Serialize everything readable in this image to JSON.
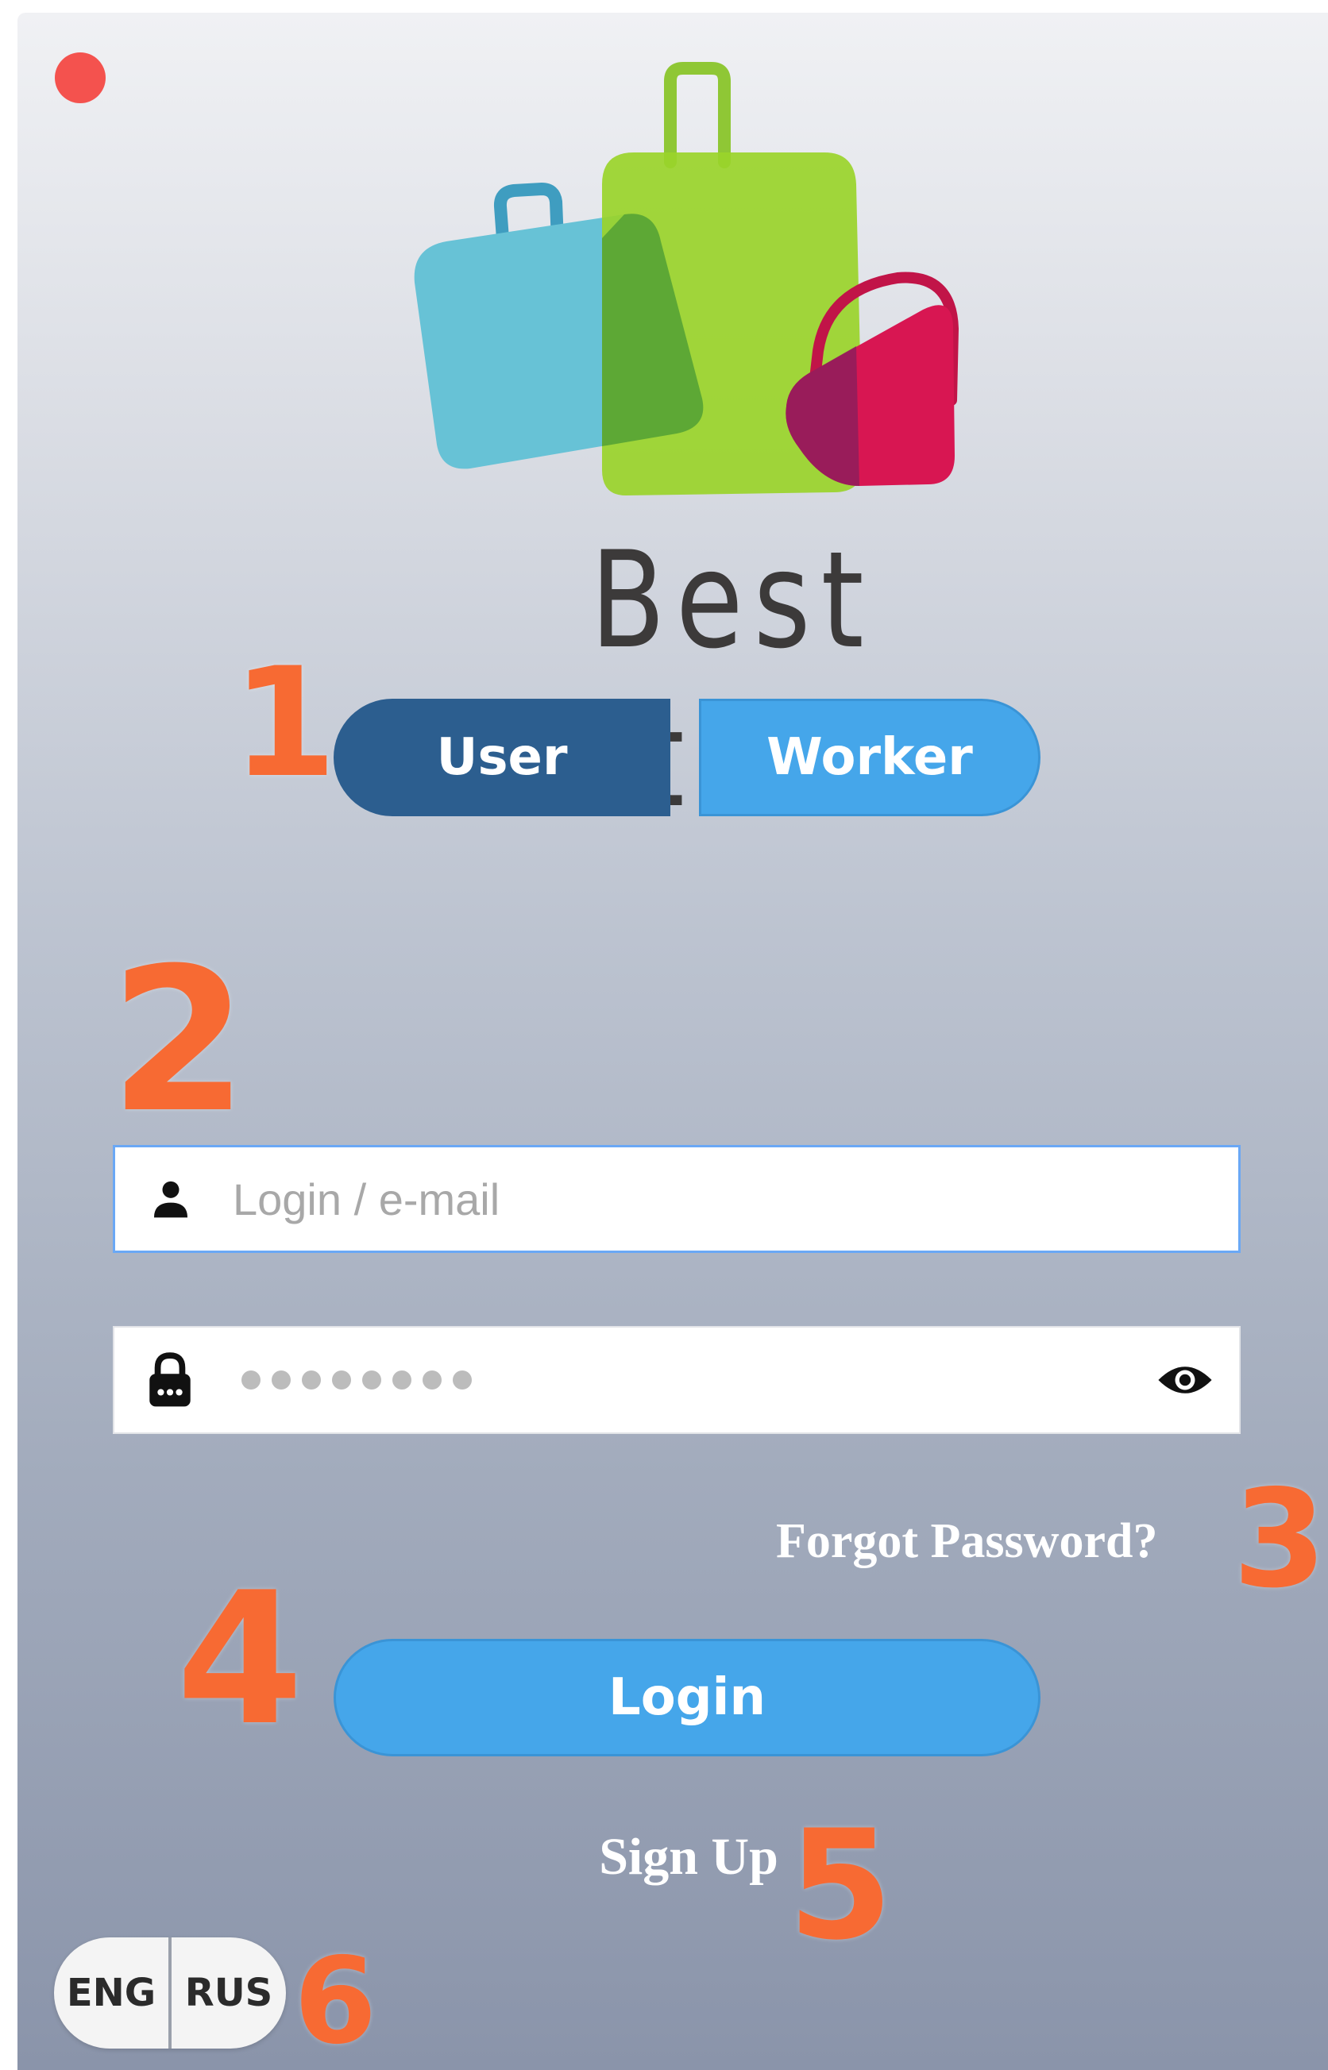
{
  "brand": {
    "name": "Best Store"
  },
  "role_toggle": {
    "user_label": "User",
    "worker_label": "Worker",
    "selected": "User"
  },
  "login_field": {
    "placeholder": "Login / e-mail",
    "value": ""
  },
  "password_field": {
    "masked_char_count": 8
  },
  "links": {
    "forgot_password": "Forgot Password?",
    "sign_up": "Sign Up"
  },
  "login_button": {
    "label": "Login"
  },
  "language": {
    "options": [
      "ENG",
      "RUS"
    ]
  },
  "callouts": [
    "1",
    "2",
    "3",
    "4",
    "5",
    "6"
  ],
  "colors": {
    "close_dot": "#f4524e",
    "callout": "#f76a33",
    "toggle_selected": "#2c5e8f",
    "accent_blue": "#45a6ea",
    "logo_teal_case": "#67c2d6",
    "logo_green_case": "#9ad42a",
    "logo_pink_bag": "#d81652"
  },
  "icons": {
    "login_field": "user-icon",
    "password_field": "lock-icon",
    "password_toggle": "eye-icon"
  }
}
